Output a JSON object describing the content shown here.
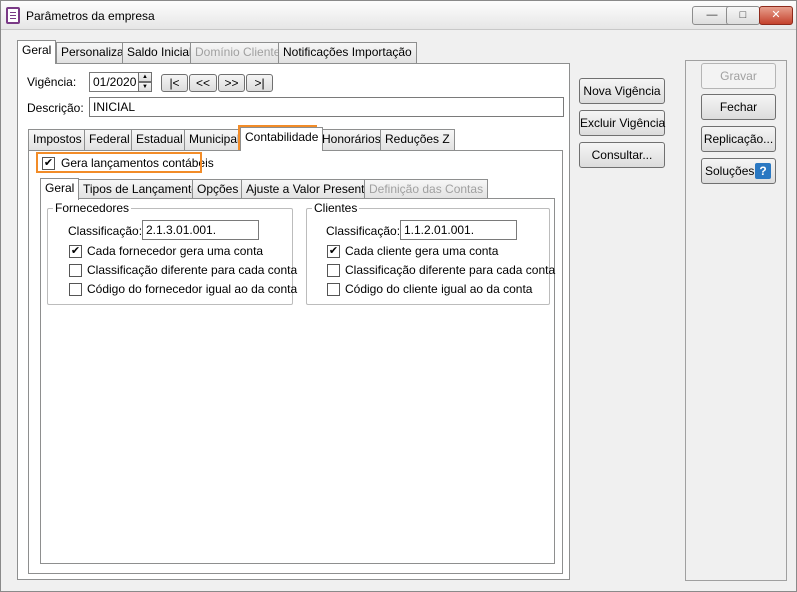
{
  "window": {
    "title": "Parâmetros da empresa",
    "minimize": "—",
    "maximize": "□",
    "close": "✕"
  },
  "main_tabs": [
    "Geral",
    "Personaliza",
    "Saldo Inicial",
    "Domínio Cliente",
    "Notificações Importação"
  ],
  "vigencia": {
    "label": "Vigência:",
    "value": "01/2020",
    "spin_up": "▲",
    "spin_down": "▼",
    "nav_first": "|<",
    "nav_prev": "<<",
    "nav_next": ">>",
    "nav_last": ">|"
  },
  "descricao": {
    "label": "Descrição:",
    "value": "INICIAL"
  },
  "sub_tabs": [
    "Impostos",
    "Federal",
    "Estadual",
    "Municipal",
    "Contabilidade",
    "Honorários",
    "Reduções Z"
  ],
  "gera": {
    "label": "Gera lançamentos contábeis",
    "checked": "✔"
  },
  "inner_tabs": [
    "Geral",
    "Tipos de Lançamento",
    "Opções",
    "Ajuste a Valor Presente",
    "Definição das Contas"
  ],
  "fornecedores": {
    "title": "Fornecedores",
    "class_label": "Classificação:",
    "class_value": "2.1.3.01.001.",
    "options": [
      {
        "label": "Cada fornecedor gera uma conta",
        "check": "✔"
      },
      {
        "label": "Classificação diferente para cada conta",
        "check": ""
      },
      {
        "label": "Código do fornecedor igual ao da conta",
        "check": ""
      }
    ]
  },
  "clientes": {
    "title": "Clientes",
    "class_label": "Classificação:",
    "class_value": "1.1.2.01.001.",
    "options": [
      {
        "label": "Cada cliente gera uma conta",
        "check": "✔"
      },
      {
        "label": "Classificação diferente para cada conta",
        "check": ""
      },
      {
        "label": "Código do cliente igual ao da conta",
        "check": ""
      }
    ]
  },
  "mid_buttons": {
    "nova": "Nova Vigência",
    "excluir": "Excluir Vigência",
    "consultar": "Consultar..."
  },
  "right_buttons": {
    "gravar": "Gravar",
    "fechar": "Fechar",
    "replicacao": "Replicação...",
    "solucoes": "Soluções",
    "help": "?"
  },
  "colors": {
    "highlight": "#f28c28",
    "help_icon": "#2a78c2"
  }
}
